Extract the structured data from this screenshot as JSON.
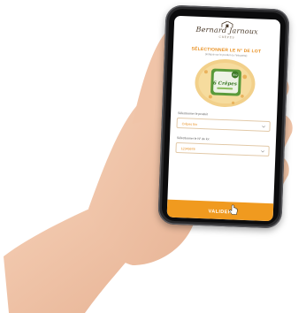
{
  "brand": {
    "name": "Bernard Jarnoux",
    "sub": "CRÊPES"
  },
  "page": {
    "title": "SÉLECTIONNER LE N° DE LOT",
    "subtitle": "(indiqué sur le produit ou l'étiquette)"
  },
  "product": {
    "name": "6 Crêpes",
    "badge": "BIO"
  },
  "fields": {
    "product_label": "Sélectionner le produit",
    "product_value": "Crêpes bio",
    "lot_label": "Sélectionner le N° de lot",
    "lot_value": "12345678"
  },
  "actions": {
    "validate_label": "VALIDER"
  },
  "colors": {
    "accent": "#f09a1f",
    "title": "#e88d1c",
    "package_green": "#5a9a3a"
  }
}
